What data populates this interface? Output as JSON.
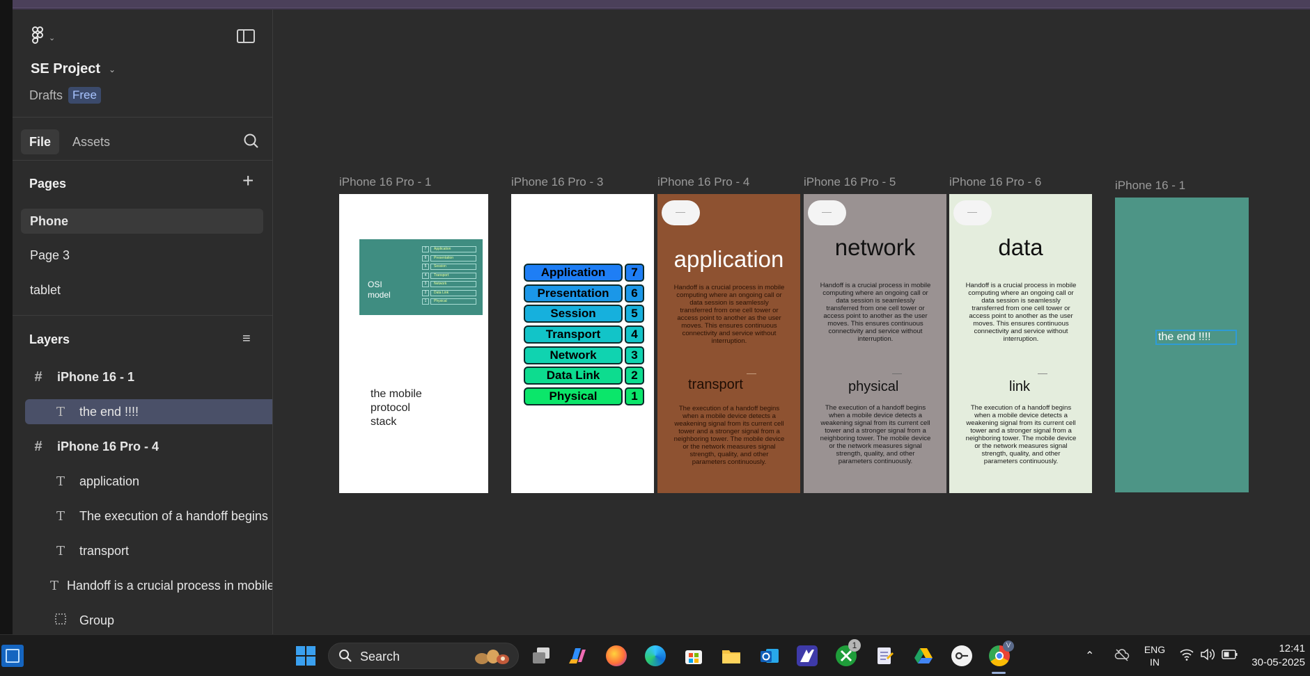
{
  "sidebar": {
    "project_name": "SE Project",
    "location": "Drafts",
    "plan_badge": "Free",
    "tabs": [
      {
        "label": "File"
      },
      {
        "label": "Assets"
      }
    ],
    "pages_title": "Pages",
    "pages": [
      {
        "label": "Phone"
      },
      {
        "label": "Page 3"
      },
      {
        "label": "tablet"
      }
    ],
    "layers_title": "Layers",
    "layers": [
      {
        "label": "iPhone 16 - 1"
      },
      {
        "label": "the end !!!!"
      },
      {
        "label": "iPhone 16 Pro - 4"
      },
      {
        "label": "application"
      },
      {
        "label": "The execution of a handoff begins"
      },
      {
        "label": "transport"
      },
      {
        "label": "Handoff is a crucial process in mobile computing"
      },
      {
        "label": "Group"
      }
    ]
  },
  "canvas": {
    "frames": [
      {
        "label": "iPhone 16 Pro - 1"
      },
      {
        "label": "iPhone 16 Pro - 3"
      },
      {
        "label": "iPhone 16 Pro - 4"
      },
      {
        "label": "iPhone 16 Pro - 5"
      },
      {
        "label": "iPhone 16 Pro - 6"
      },
      {
        "label": "iPhone 16 - 1"
      }
    ],
    "osi_card_title": "OSI\nmodel",
    "osi_mini_layers": [
      "Application",
      "Presentation",
      "Session",
      "Transport",
      "Network",
      "Data Link",
      "Physical"
    ],
    "osi_mini_numbers": [
      "7",
      "6",
      "5",
      "4",
      "3",
      "2",
      "1"
    ],
    "protocol_text": "the mobile\nprotocol\nstack",
    "osi_stack": [
      {
        "label": "Application",
        "num": "7",
        "color": "#1e7ef5"
      },
      {
        "label": "Presentation",
        "num": "6",
        "color": "#1b97e8"
      },
      {
        "label": "Session",
        "num": "5",
        "color": "#16b0dd"
      },
      {
        "label": "Transport",
        "num": "4",
        "color": "#12c4c8"
      },
      {
        "label": "Network",
        "num": "3",
        "color": "#10d3b0"
      },
      {
        "label": "Data Link",
        "num": "2",
        "color": "#0ddc8f"
      },
      {
        "label": "Physical",
        "num": "1",
        "color": "#0be66a"
      }
    ],
    "handoff_paragraph": "Handoff is a crucial process in mobile computing where an ongoing call or data session is seamlessly transferred from one cell tower or access point to another as the user moves. This ensures continuous connectivity and service without interruption.",
    "execution_paragraph": "The execution of a handoff begins when a mobile device detects a weakening signal from its current cell tower and a stronger signal from a neighboring tower. The mobile device or the network measures signal strength, quality, and other parameters continuously.",
    "slides": [
      {
        "title": "application",
        "subtitle": "transport"
      },
      {
        "title": "network",
        "subtitle": "physical"
      },
      {
        "title": "data",
        "subtitle": "link"
      }
    ],
    "end_text": "the end !!!!"
  },
  "taskbar": {
    "search_label": "Search",
    "language": "ENG",
    "region": "IN",
    "time": "12:41",
    "date": "30-05-2025",
    "xbox_badge": "1",
    "chrome_profile": "V",
    "icons": [
      "widgets-icon",
      "start-icon",
      "task-view-icon",
      "copilot-icon",
      "firefox-icon",
      "edge-icon",
      "store-icon",
      "file-explorer-icon",
      "outlook-icon",
      "app-icon",
      "xbox-icon",
      "notepad-icon",
      "drive-icon",
      "key-icon",
      "chrome-icon"
    ]
  },
  "colors": {
    "accent_selection": "#4a5068",
    "free_badge": "#3b4a6b",
    "frame_application": "#8e5231",
    "frame_network": "#9a9292",
    "frame_data": "#e4eddd",
    "frame_end": "#4d9586"
  }
}
